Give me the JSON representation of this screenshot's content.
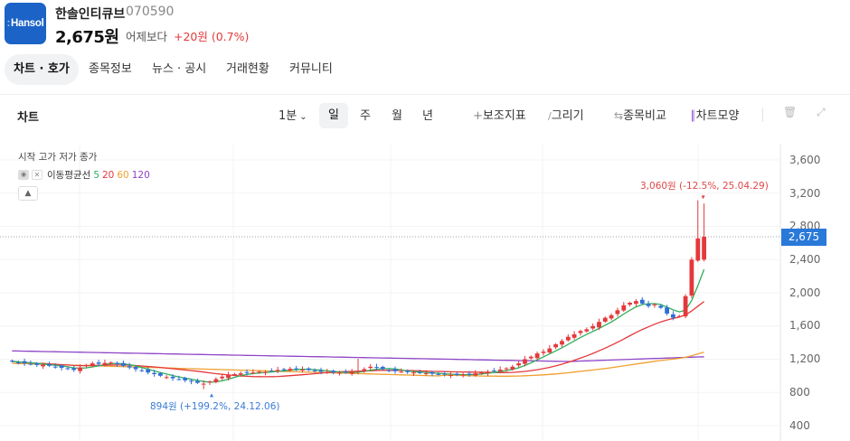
{
  "header": {
    "logo_text": "Hansol",
    "stock_name": "한솔인티큐브",
    "stock_code": "070590",
    "price": "2,675원",
    "vs_label": "어제보다",
    "change": "+20원 (0.7%)",
    "up_color": "#e5383b"
  },
  "tabs": [
    "차트 · 호가",
    "종목정보",
    "뉴스 · 공시",
    "거래현황",
    "커뮤니티"
  ],
  "chart_panel": {
    "title": "차트",
    "interval": "1분",
    "periods": [
      "일",
      "주",
      "월",
      "년"
    ],
    "tools": [
      "보조지표",
      "그리기",
      "종목비교",
      "차트모양"
    ],
    "ohlc_legend": "시작 고가 저가 종가",
    "ma_label": "이동평균선",
    "ma_periods": [
      {
        "n": "5",
        "color": "#2fae5a"
      },
      {
        "n": "20",
        "color": "#e5383b"
      },
      {
        "n": "60",
        "color": "#f0a030"
      },
      {
        "n": "120",
        "color": "#8e44c7"
      }
    ],
    "current_price": "2,675",
    "high_annotation": "3,060원 (-12.5%, 25.04.29)",
    "low_annotation": "894원 (+199.2%, 24.12.06)"
  },
  "chart_data": {
    "type": "candlestick",
    "y_ticks": [
      "3,600",
      "3,200",
      "2,800",
      "2,400",
      "2,000",
      "1,600",
      "1,200",
      "800",
      "400"
    ],
    "ylim": [
      400,
      3600
    ],
    "current_price": 2675,
    "high": {
      "price": 3060,
      "date": "25.04.29"
    },
    "low": {
      "price": 894,
      "date": "24.12.06"
    },
    "closes": [
      1175,
      1160,
      1150,
      1140,
      1130,
      1135,
      1120,
      1110,
      1095,
      1085,
      1070,
      1100,
      1130,
      1150,
      1145,
      1155,
      1160,
      1140,
      1120,
      1100,
      1080,
      1060,
      1040,
      1020,
      1000,
      985,
      970,
      960,
      945,
      930,
      915,
      905,
      930,
      960,
      990,
      1010,
      1020,
      1030,
      1035,
      1040,
      1050,
      1045,
      1060,
      1070,
      1080,
      1085,
      1080,
      1075,
      1070,
      1060,
      1050,
      1045,
      1040,
      1038,
      1040,
      1045,
      1060,
      1080,
      1110,
      1100,
      1080,
      1065,
      1055,
      1050,
      1045,
      1040,
      1035,
      1030,
      1025,
      1020,
      1015,
      1010,
      1010,
      1015,
      1020,
      1030,
      1040,
      1050,
      1060,
      1075,
      1090,
      1110,
      1150,
      1200,
      1230,
      1270,
      1290,
      1330,
      1380,
      1420,
      1470,
      1500,
      1540,
      1560,
      1600,
      1650,
      1700,
      1730,
      1790,
      1850,
      1880,
      1900,
      1870,
      1840,
      1860,
      1820,
      1750,
      1700,
      1720,
      1960,
      2400,
      2655,
      2675
    ]
  }
}
